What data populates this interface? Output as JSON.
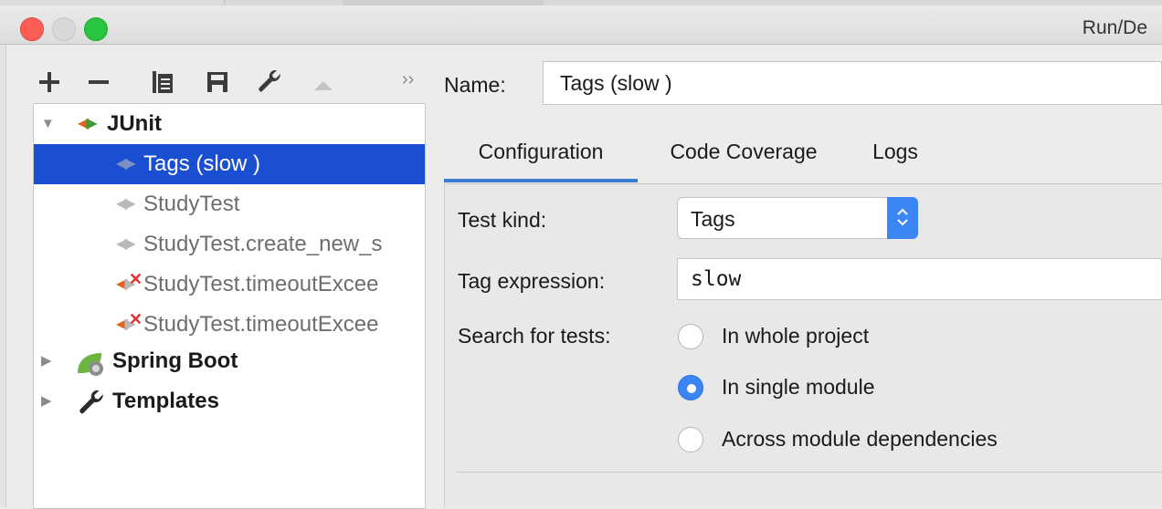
{
  "window": {
    "title": "Run/De"
  },
  "toolbar": {
    "add_icon": "plus-icon",
    "remove_icon": "minus-icon",
    "copy_icon": "copy-icon",
    "save_icon": "save-icon",
    "edit_defaults_icon": "wrench-icon",
    "move_up_icon": "triangle-up-icon",
    "more_label": "››"
  },
  "tree": {
    "groups": {
      "junit": {
        "label": "JUnit",
        "icon": "junit-icon"
      },
      "spring_boot": {
        "label": "Spring Boot",
        "icon": "spring-boot-icon"
      },
      "templates": {
        "label": "Templates",
        "icon": "wrench-icon"
      }
    },
    "items": [
      {
        "label": "Tags (slow )",
        "selected": true,
        "status": "none"
      },
      {
        "label": "StudyTest",
        "selected": false,
        "status": "none"
      },
      {
        "label": "StudyTest.create_new_s",
        "selected": false,
        "status": "none"
      },
      {
        "label": "StudyTest.timeoutExcee",
        "selected": false,
        "status": "failed"
      },
      {
        "label": "StudyTest.timeoutExcee",
        "selected": false,
        "status": "failed"
      }
    ]
  },
  "form": {
    "name_label": "Name:",
    "name_value": "Tags (slow )",
    "tabs": [
      {
        "label": "Configuration",
        "active": true
      },
      {
        "label": "Code Coverage",
        "active": false
      },
      {
        "label": "Logs",
        "active": false
      }
    ],
    "test_kind_label": "Test kind:",
    "test_kind_value": "Tags",
    "tag_expression_label": "Tag expression:",
    "tag_expression_value": "slow",
    "search_label": "Search for tests:",
    "search_options": [
      {
        "label": "In whole project",
        "checked": false
      },
      {
        "label": "In single module",
        "checked": true
      },
      {
        "label": "Across module dependencies",
        "checked": false
      }
    ]
  },
  "colors": {
    "selection": "#1a4fd1",
    "accent": "#3b85f5",
    "junit_left": "#e2651e",
    "junit_right": "#3c9c3a",
    "fail": "#e03131"
  }
}
